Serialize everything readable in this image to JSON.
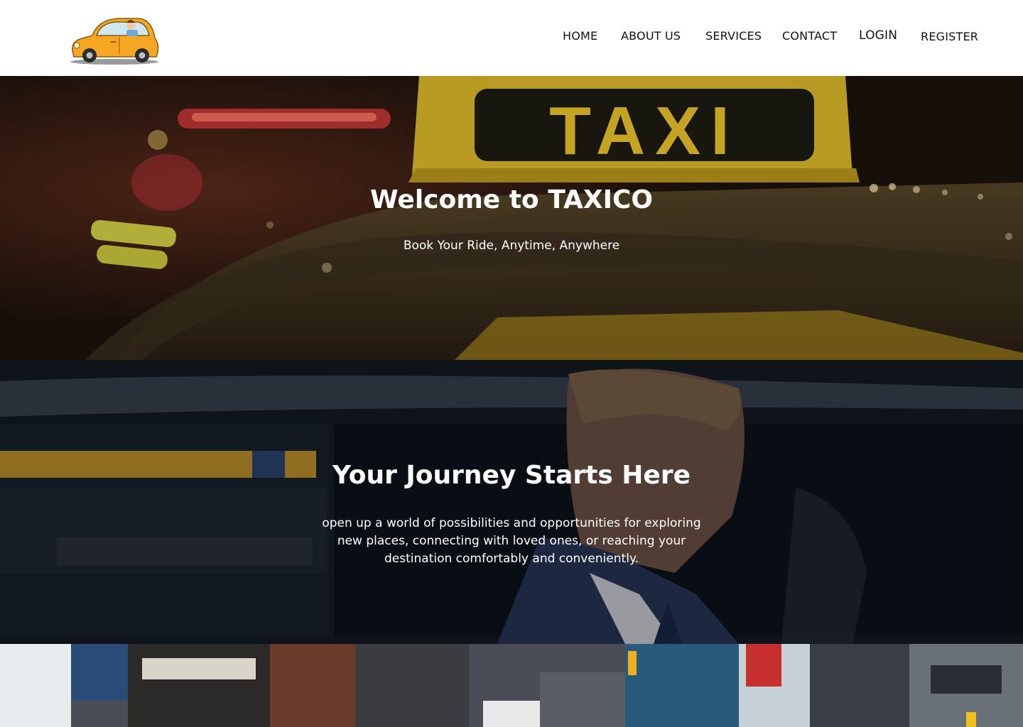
{
  "header": {
    "logo_name": "taxi-cartoon-logo",
    "nav": [
      {
        "label": "HOME"
      },
      {
        "label": "ABOUT US"
      },
      {
        "label": "SERVICES"
      },
      {
        "label": "CONTACT"
      },
      {
        "label": "LOGIN"
      },
      {
        "label": "REGISTER"
      }
    ]
  },
  "hero1": {
    "title": "Welcome to TAXICO",
    "subtitle": "Book Your Ride, Anytime, Anywhere",
    "sign_text": "TAXI"
  },
  "hero2": {
    "title": "Your Journey Starts Here",
    "text": "open up a world of possibilities and opportunities for exploring new places, connecting with loved ones, or reaching your destination comfortably and conveniently."
  },
  "colors": {
    "taxi_yellow": "#f5a623",
    "sign_yellow": "#e8c02a",
    "text_white": "#ffffff"
  }
}
